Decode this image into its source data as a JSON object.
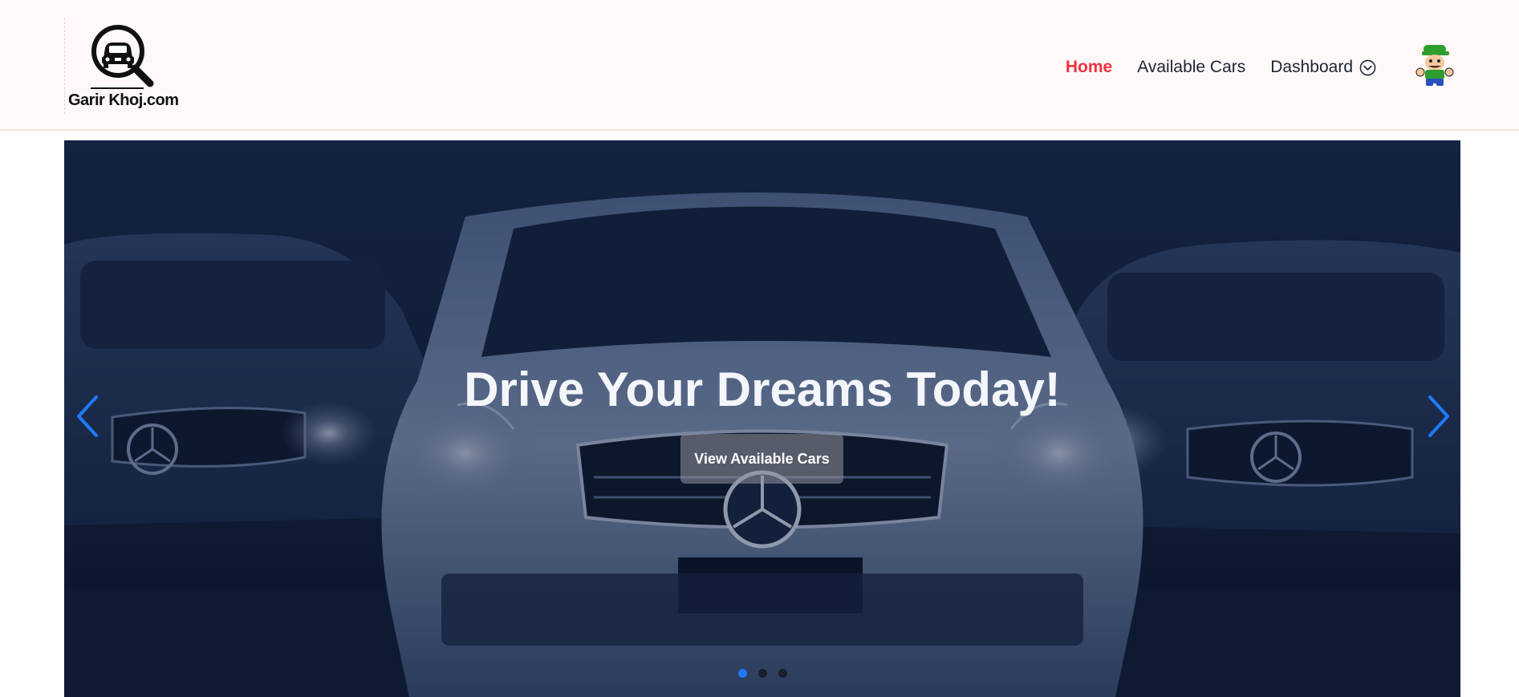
{
  "brand": {
    "name": "Garir Khoj.com"
  },
  "nav": {
    "links": [
      {
        "label": "Home",
        "active": true
      },
      {
        "label": "Available Cars",
        "active": false
      },
      {
        "label": "Dashboard",
        "active": false
      }
    ],
    "dropdown_icon": "chevron-down-circle-icon",
    "active_color": "#ef3340"
  },
  "hero": {
    "title": "Drive Your Dreams Today!",
    "button_label": "View Available Cars",
    "prev_icon": "chevron-left-icon",
    "next_icon": "chevron-right-icon",
    "slide_count": 3,
    "active_slide": 1,
    "arrow_color": "#1f7bff"
  },
  "user": {
    "avatar_icon": "cartoon-avatar-icon"
  }
}
